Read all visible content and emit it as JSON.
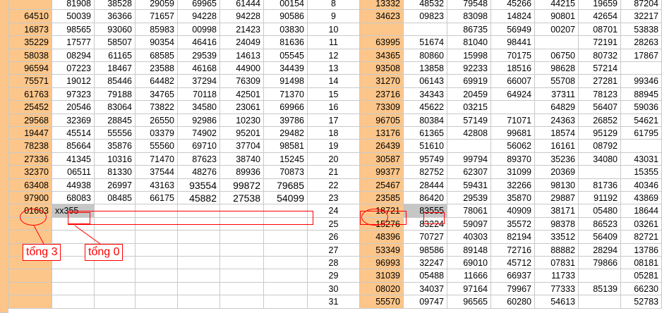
{
  "sheet": {
    "row_count": 24,
    "highlight_row_index": 16,
    "left_cols": [
      [
        "",
        "64510",
        "16873",
        "35229",
        "58038",
        "96594",
        "75571",
        "61763",
        "25452",
        "29568",
        "19447",
        "78238",
        "27336",
        "32370",
        "63408",
        "97900",
        "01603",
        "",
        "",
        "",
        "",
        "",
        "",
        ""
      ],
      [
        "81908",
        "50039",
        "98565",
        "17577",
        "08294",
        "07223",
        "19012",
        "97323",
        "20546",
        "32369",
        "45514",
        "85664",
        "41345",
        "06511",
        "44938",
        "68083",
        "xx355",
        "",
        "",
        "",
        "",
        "",
        "",
        ""
      ],
      [
        "38528",
        "36366",
        "93060",
        "58507",
        "61165",
        "18467",
        "85446",
        "79188",
        "83064",
        "28845",
        "55556",
        "35876",
        "10316",
        "81330",
        "26997",
        "08485",
        "",
        "",
        "",
        "",
        "",
        "",
        "",
        ""
      ],
      [
        "29059",
        "71657",
        "85983",
        "90354",
        "68585",
        "23588",
        "64482",
        "34765",
        "73822",
        "26550",
        "03379",
        "55560",
        "71470",
        "37544",
        "43163",
        "66175",
        "",
        "",
        "",
        "",
        "",
        "",
        "",
        ""
      ],
      [
        "69965",
        "94228",
        "00998",
        "46416",
        "29539",
        "46168",
        "37294",
        "70118",
        "34580",
        "92986",
        "74902",
        "69710",
        "87623",
        "48276",
        "93554",
        "45882",
        "",
        "",
        "",
        "",
        "",
        "",
        "",
        ""
      ],
      [
        "61444",
        "94228",
        "21423",
        "24049",
        "14613",
        "44900",
        "76309",
        "42501",
        "23061",
        "10230",
        "95201",
        "37704",
        "38740",
        "89936",
        "99872",
        "27538",
        "",
        "",
        "",
        "",
        "",
        "",
        "",
        ""
      ],
      [
        "00154",
        "90586",
        "03830",
        "81636",
        "05545",
        "34439",
        "91498",
        "71370",
        "69966",
        "39786",
        "29482",
        "98581",
        "15245",
        "70873",
        "79685",
        "54099",
        "",
        "",
        "",
        "",
        "",
        "",
        "",
        ""
      ]
    ],
    "row_numbers": [
      "8",
      "9",
      "10",
      "11",
      "12",
      "13",
      "14",
      "15",
      "16",
      "17",
      "18",
      "19",
      "20",
      "21",
      "22",
      "23",
      "24",
      "25",
      "26",
      "27",
      "28",
      "29",
      "30",
      "31"
    ],
    "right_cols": [
      [
        "13332",
        "34623",
        "",
        "63995",
        "34365",
        "93508",
        "31270",
        "23716",
        "73309",
        "96705",
        "13176",
        "26439",
        "30587",
        "99377",
        "25467",
        "23585",
        "18721",
        "15276",
        "48396",
        "53349",
        "96993",
        "31039",
        "08020",
        "55570"
      ],
      [
        "48532",
        "09823",
        "",
        "51674",
        "80860",
        "13858",
        "06143",
        "34343",
        "45622",
        "80384",
        "61365",
        "51610",
        "95749",
        "82752",
        "28444",
        "86420",
        "83555",
        "83224",
        "70727",
        "98586",
        "32247",
        "05488",
        "34037",
        "09747"
      ],
      [
        "79548",
        "83098",
        "86735",
        "81040",
        "15998",
        "92233",
        "69919",
        "20459",
        "03215",
        "57149",
        "42808",
        "",
        "99794",
        "62307",
        "59431",
        "29539",
        "78061",
        "59097",
        "40303",
        "89148",
        "69010",
        "11666",
        "97164",
        "96565"
      ],
      [
        "45266",
        "14824",
        "56949",
        "98441",
        "70175",
        "18516",
        "66007",
        "64924",
        "",
        "71071",
        "99681",
        "56062",
        "89370",
        "31099",
        "32266",
        "35870",
        "40909",
        "35572",
        "82194",
        "72716",
        "45712",
        "66937",
        "79967",
        "60280"
      ],
      [
        "44215",
        "90801",
        "00207",
        "",
        "06750",
        "98628",
        "55708",
        "37311",
        "64829",
        "24363",
        "18574",
        "16161",
        "35236",
        "20369",
        "98130",
        "29887",
        "38171",
        "98378",
        "33512",
        "88882",
        "07831",
        "11733",
        "77333",
        "54613"
      ],
      [
        "19659",
        "42654",
        "08701",
        "72191",
        "80732",
        "57214",
        "27281",
        "78123",
        "56407",
        "26852",
        "95129",
        "08792",
        "34080",
        "",
        "81736",
        "91192",
        "05480",
        "86523",
        "56409",
        "28294",
        "79866",
        "",
        "85139",
        ""
      ],
      [
        "87204",
        "32217",
        "53838",
        "28263",
        "17867",
        "",
        "99346",
        "88945",
        "59036",
        "54621",
        "61795",
        "",
        "43031",
        "15355",
        "40346",
        "43869",
        "18644",
        "03261",
        "82721",
        "13786",
        "08181",
        "05281",
        "66230",
        "52783"
      ]
    ]
  },
  "annotations": {
    "left_label": "tổng 3",
    "right_label": "tổng 0"
  },
  "colors": {
    "orange": "#fcc68a",
    "grid": "#c9c9c9",
    "highlight_grey": "#c6c6c6",
    "annotation_red": "#ff0000"
  }
}
